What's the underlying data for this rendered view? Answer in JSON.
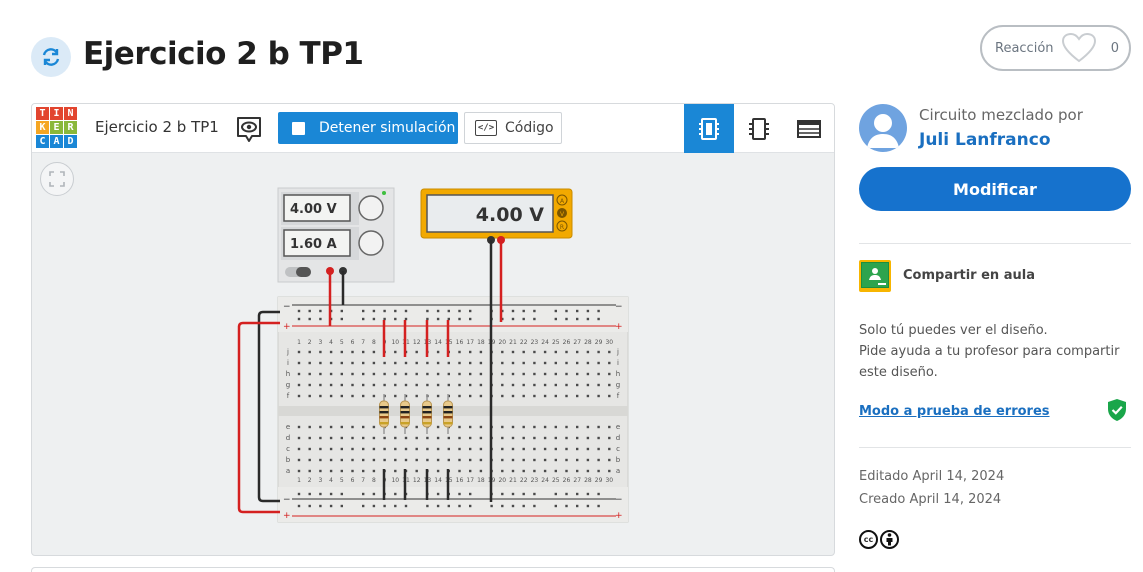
{
  "header": {
    "title": "Ejercicio 2 b TP1",
    "like_label": "Reacción",
    "like_count": "0"
  },
  "editor": {
    "logo_letters": [
      "T",
      "I",
      "N",
      "K",
      "E",
      "R",
      "C",
      "A",
      "D"
    ],
    "design_name": "Ejercicio 2 b TP1",
    "sim_button_label": "Detener simulación",
    "code_button_label": "Código",
    "code_icon_text": "</>",
    "views": [
      "circuit-view",
      "schematic-view",
      "component-list-view"
    ],
    "active_view": "circuit-view"
  },
  "circuit": {
    "power_supply": {
      "voltage": "4.00 V",
      "current": "1.60 A"
    },
    "multimeter": {
      "reading": "4.00 V",
      "modes": [
        "A",
        "V",
        "R"
      ]
    },
    "breadboard_columns_top": [
      "1",
      "2",
      "3",
      "4",
      "5",
      "6",
      "7",
      "8",
      "9",
      "10",
      "11",
      "12",
      "13",
      "14",
      "15",
      "16",
      "17",
      "18",
      "19",
      "20",
      "21",
      "22",
      "23",
      "24",
      "25",
      "26",
      "27",
      "28",
      "29",
      "30"
    ],
    "breadboard_rows_top": [
      "j",
      "i",
      "h",
      "g",
      "f"
    ],
    "breadboard_rows_bottom": [
      "e",
      "d",
      "c",
      "b",
      "a"
    ],
    "rail_plus": "+",
    "rail_minus": "−",
    "resistor_count": 4
  },
  "sidebar": {
    "remixed_by_label": "Circuito mezclado por",
    "author": "Juli Lanfranco",
    "modify_label": "Modificar",
    "share_classroom_label": "Compartir en aula",
    "info_line1": "Solo tú puedes ver el diseño.",
    "info_line2": "Pide ayuda a tu profesor para compartir este diseño.",
    "debug_link": "Modo a prueba de errores",
    "edited": "Editado April 14, 2024",
    "created": "Creado April 14, 2024"
  },
  "colors": {
    "accent": "#1a87d6",
    "link": "#1a6fc0",
    "wire_red": "#d42020",
    "wire_black": "#2a2a2a",
    "multimeter_body": "#f2a900",
    "shield_green": "#1aa64a"
  }
}
